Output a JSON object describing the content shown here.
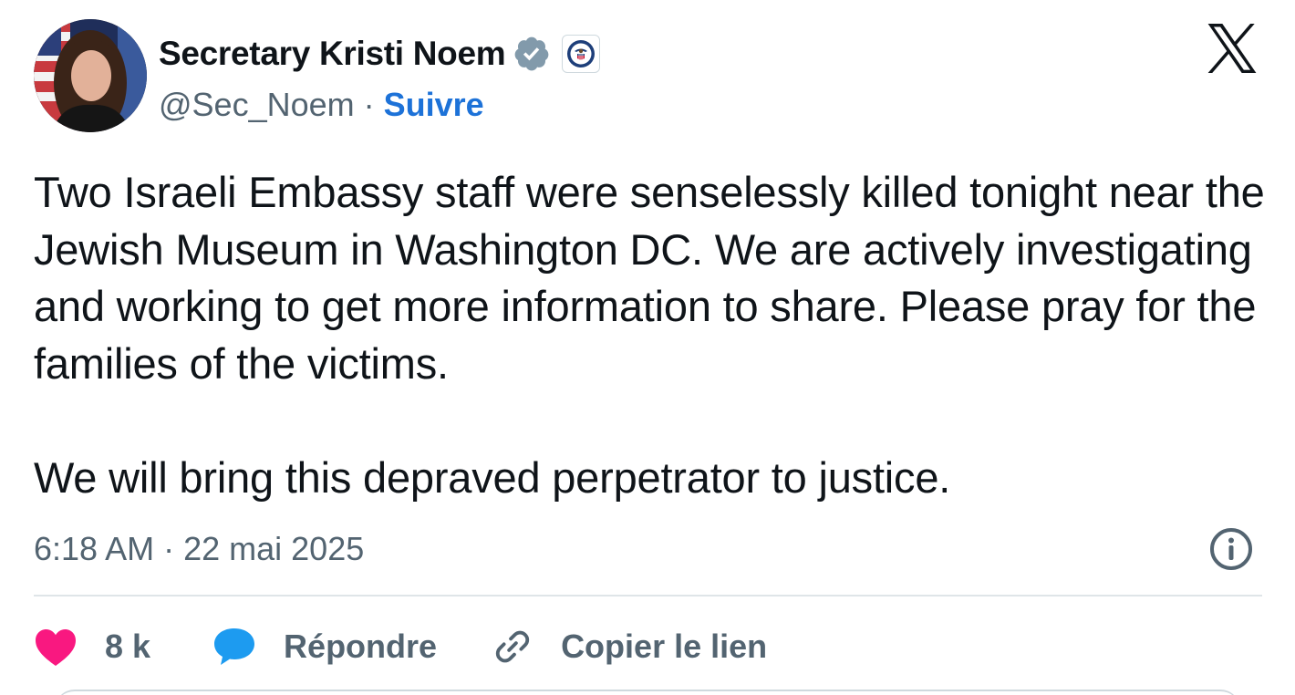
{
  "author": {
    "display_name": "Secretary Kristi Noem",
    "handle": "@Sec_Noem",
    "separator": "·",
    "follow_label": "Suivre",
    "verified_color": "#829aab",
    "follow_color": "#1d72d8"
  },
  "tweet": {
    "paragraphs": [
      "Two Israeli Embassy staff were senselessly killed tonight near the Jewish Museum in Washington DC. We are actively investigating and working to get more information to share. Please pray for the families of the victims.",
      "We will bring this depraved perpetrator to justice."
    ]
  },
  "meta": {
    "time": "6:18 AM",
    "separator": "·",
    "date": "22 mai 2025"
  },
  "actions": {
    "like_count": "8 k",
    "reply_label": "Répondre",
    "copy_link_label": "Copier le lien",
    "like_color": "#f91880",
    "reply_color": "#1d9bf0"
  },
  "icons": {
    "platform_logo": "x-logo-icon",
    "verified": "verified-badge-icon",
    "affiliation": "dhs-seal-icon",
    "info": "info-icon",
    "like": "heart-icon",
    "reply": "speech-bubble-icon",
    "copy_link": "link-icon"
  }
}
